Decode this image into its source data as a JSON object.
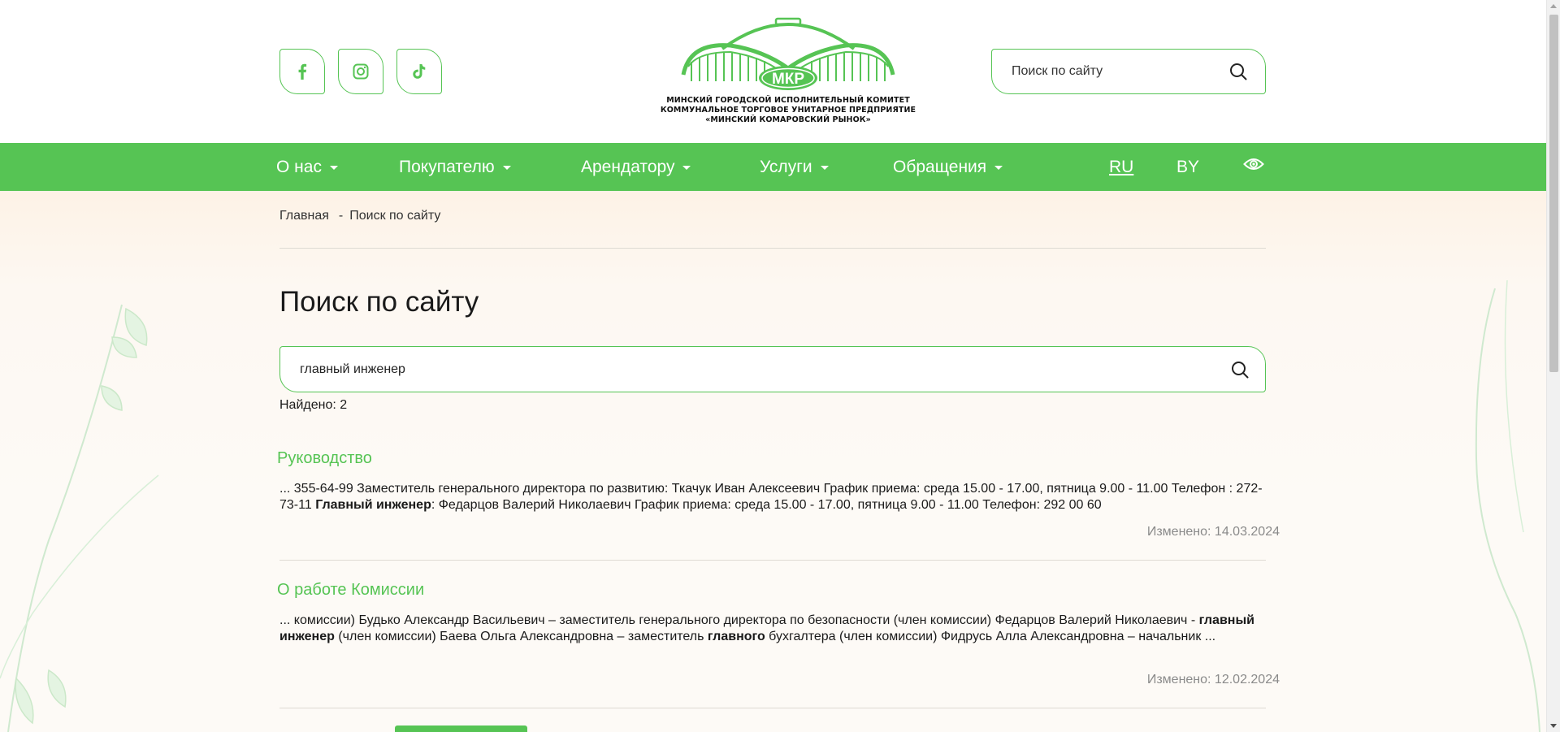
{
  "header": {
    "social": [
      {
        "name": "facebook-icon"
      },
      {
        "name": "instagram-icon"
      },
      {
        "name": "tiktok-icon"
      }
    ],
    "logo": {
      "badge": "МКР",
      "lines": [
        "МИНСКИЙ ГОРОДСКОЙ ИСПОЛНИТЕЛЬНЫЙ КОМИТЕТ",
        "КОММУНАЛЬНОЕ ТОРГОВОЕ УНИТАРНОЕ ПРЕДПРИЯТИЕ",
        "«МИНСКИЙ КОМАРОВСКИЙ РЫНОК»"
      ]
    },
    "search": {
      "placeholder": "Поиск по сайту"
    }
  },
  "nav": {
    "items": [
      {
        "label": "О нас"
      },
      {
        "label": "Покупателю"
      },
      {
        "label": "Арендатору"
      },
      {
        "label": "Услуги"
      },
      {
        "label": "Обращения"
      }
    ],
    "languages": [
      {
        "label": "RU",
        "active": true
      },
      {
        "label": "BY",
        "active": false
      }
    ],
    "accessibility_icon": "eye-icon"
  },
  "breadcrumb": {
    "home": "Главная",
    "separator": "-",
    "current": "Поиск по сайту"
  },
  "page": {
    "title": "Поиск по сайту",
    "search_value": "главный инженер",
    "found_text": "Найдено: 2"
  },
  "results": [
    {
      "title": "Руководство",
      "snippet_parts": [
        {
          "text": "... 355-64-99 Заместитель генерального директора по развитию: Ткачук Иван Алексеевич График приема: среда 15.00 - 17.00, пятница 9.00 - 11.00 Телефон : 272-73-11 ",
          "bold": false
        },
        {
          "text": "Главный инженер",
          "bold": true
        },
        {
          "text": ": Федарцов Валерий Николаевич График приема: среда 15.00 - 17.00, пятница 9.00 - 11.00 Телефон: 292 00 60",
          "bold": false
        }
      ],
      "changed": "Изменено: 14.03.2024"
    },
    {
      "title": "О работе Комиссии",
      "snippet_parts": [
        {
          "text": "... комиссии) Будько Александр Васильевич – заместитель генерального директора по безопасности (член комиссии) Федарцов Валерий Николаевич - ",
          "bold": false
        },
        {
          "text": "главный инженер",
          "bold": true
        },
        {
          "text": " (член комиссии) Баева Ольга Александровна – заместитель ",
          "bold": false
        },
        {
          "text": "главного",
          "bold": true
        },
        {
          "text": " бухгалтера (член комиссии) Фидрусь Алла Александровна – начальник ...",
          "bold": false
        }
      ],
      "changed": "Изменено: 12.02.2024"
    }
  ],
  "colors": {
    "accent": "#56c454",
    "muted": "#8a8a8a",
    "background": "#fdf9f3"
  }
}
